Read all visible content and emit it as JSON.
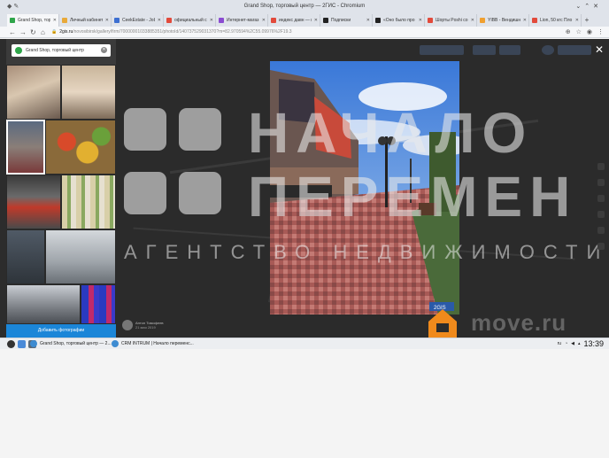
{
  "window": {
    "title": "Grand Shop, торговый центр — 2ГИС - Chromium"
  },
  "tabs": [
    {
      "label": "Grand Shop, тор",
      "color": "#2fa54a",
      "active": true
    },
    {
      "label": "Личный кабинет",
      "color": "#e8a93a",
      "active": false
    },
    {
      "label": "CeekEstate - Jobs",
      "color": "#3d6fd1",
      "active": false
    },
    {
      "label": "официальный с",
      "color": "#e24a3b",
      "active": false
    },
    {
      "label": "Интернет-магаз",
      "color": "#8a4bd1",
      "active": false
    },
    {
      "label": "индекс давн — г",
      "color": "#e24a3b",
      "active": false
    },
    {
      "label": "Подписки",
      "color": "#222222",
      "active": false
    },
    {
      "label": "«Оно было про",
      "color": "#222222",
      "active": false
    },
    {
      "label": "Шорты Poshi со",
      "color": "#e24a3b",
      "active": false
    },
    {
      "label": "YIBB - Вендишн",
      "color": "#f0a030",
      "active": false
    },
    {
      "label": "Lion, 50 кгс Пло",
      "color": "#e24a3b",
      "active": false
    }
  ],
  "address": {
    "host": "2gis.ru",
    "path": "/novosibirsk/gallery/firm/70000001033885351/photoId/140737529031370?m=82.970594%2C55.09976%2F19.3"
  },
  "search": {
    "value": "Grand Shop, торговый центр"
  },
  "sidebar": {
    "add_photo_label": "Добавить фотографии"
  },
  "watermark": {
    "line1": "НАЧАЛО",
    "line2": "ПЕРЕМЕН",
    "subtitle": "АГЕНТСТВО НЕДВИЖИМОСТИ"
  },
  "author": {
    "name": "Антон Тимофеев",
    "date": "21 мая 2019"
  },
  "photo": {
    "badge": "2GIS"
  },
  "move": {
    "text": "move.ru"
  },
  "taskbar": {
    "items": [
      {
        "label": "Grand Shop, торговый центр — 2...",
        "color": "#3d8bd1"
      },
      {
        "label": "CRM INTRUM | Начало переменс...",
        "color": "#3d8bd1"
      }
    ],
    "lang": "ru",
    "clock": "13:39"
  },
  "colors": {
    "accent": "#1b86d8",
    "brand_2gis": "#2fa54a",
    "move_orange": "#f08a1c"
  }
}
